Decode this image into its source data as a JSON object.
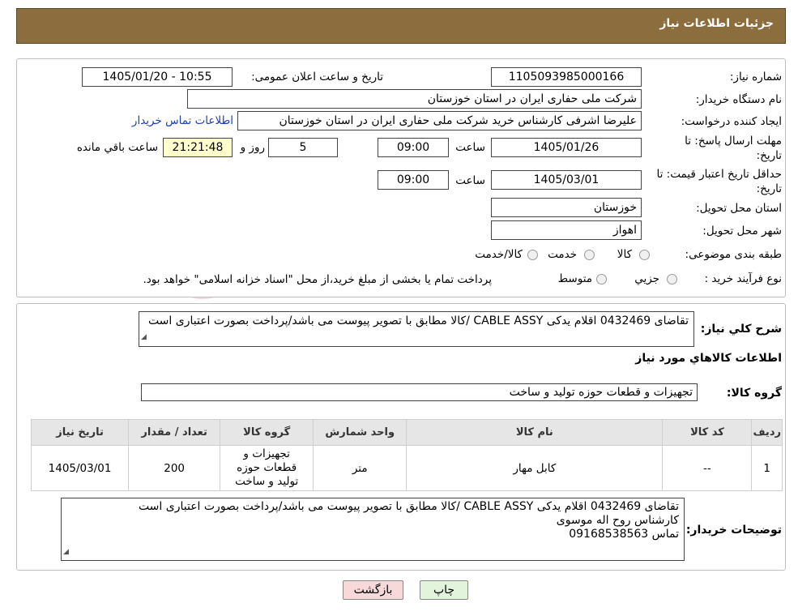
{
  "header": {
    "title": "جزئیات اطلاعات نیاز"
  },
  "form": {
    "need_number_label": "شماره نیاز:",
    "need_number": "1105093985000166",
    "announce_label": "تاریخ و ساعت اعلان عمومی:",
    "announce_value": "1405/01/20 - 10:55",
    "buyer_org_label": "نام دستگاه خریدار:",
    "buyer_org": "شرکت ملی حفاری ایران در استان خوزستان",
    "creator_label": "ایجاد کننده درخواست:",
    "creator": "علیرضا اشرفی کارشناس خرید شرکت ملی حفاری ایران در استان خوزستان",
    "contact_link": "اطلاعات تماس خریدار",
    "deadline_label": "مهلت ارسال پاسخ: تا تاریخ:",
    "deadline_date": "1405/01/26",
    "time_label": "ساعت",
    "deadline_time": "09:00",
    "days_value": "5",
    "days_label": "روز و",
    "remaining_time": "21:21:48",
    "remaining_label": "ساعت باقي مانده",
    "validity_label": "حداقل تاریخ اعتبار قیمت: تا تاریخ:",
    "validity_date": "1405/03/01",
    "validity_time": "09:00",
    "province_label": "استان محل تحویل:",
    "province": "خوزستان",
    "city_label": "شهر محل تحویل:",
    "city": "اهواز",
    "category_label": "طبقه بندی موضوعی:",
    "category_options": [
      "کالا",
      "خدمت",
      "کالا/خدمت"
    ],
    "process_label": "نوع فرآیند خرید :",
    "process_options": [
      "جزیي",
      "متوسط"
    ],
    "process_note": "پرداخت تمام یا بخشی از مبلغ خرید،از محل \"اسناد خزانه اسلامی\" خواهد بود."
  },
  "summary": {
    "desc_label": "شرح کلي نياز:",
    "desc": "تقاضای 0432469 اقلام یدکی CABLE ASSY /کالا مطابق با تصویر پیوست می باشد/پرداخت بصورت اعتباری است",
    "goods_info_label": "اطلاعات کالاهاي مورد نياز",
    "group_label": "گروه کالا:",
    "group": "تجهیزات و قطعات حوزه تولید و ساخت"
  },
  "table": {
    "headers": [
      "ردیف",
      "کد کالا",
      "نام کالا",
      "واحد شمارش",
      "گروه کالا",
      "تعداد / مقدار",
      "تاریخ نیاز"
    ],
    "rows": [
      [
        "1",
        "--",
        "کابل مهار",
        "متر",
        "تجهیزات و قطعات حوزه تولید و ساخت",
        "200",
        "1405/03/01"
      ]
    ]
  },
  "notes": {
    "label": "توضیحات خریدار:",
    "line1": "تقاضای 0432469 اقلام یدکی CABLE ASSY /کالا مطابق با تصویر پیوست می باشد/پرداخت بصورت اعتباری است",
    "line2": "کارشناس روح اله موسوی",
    "line3": "تماس 09168538563"
  },
  "buttons": {
    "print": "چاپ",
    "back": "بازگشت"
  },
  "colors": {
    "header_bg": "#8c6d3d",
    "link": "#1a3fb0",
    "back_btn": "#f7d9d9",
    "print_btn": "#e2f5dc"
  }
}
